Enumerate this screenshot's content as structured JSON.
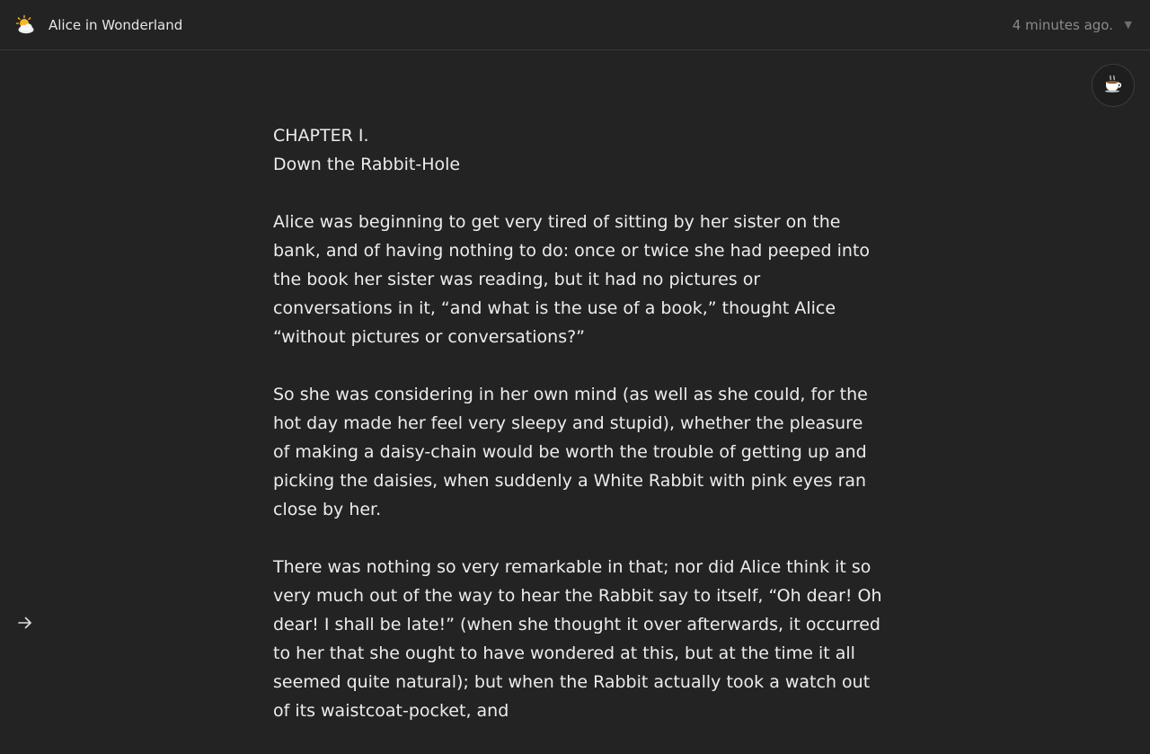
{
  "header": {
    "app_icon": "sun-behind-cloud-icon",
    "title": "Alice in Wonderland",
    "timestamp": "4 minutes ago.",
    "timestamp_menu_icon": "caret-down-icon"
  },
  "toolbar": {
    "theme_button_icon": "hot-beverage-icon"
  },
  "document": {
    "chapter_number": "CHAPTER I.",
    "chapter_title": "Down the Rabbit-Hole",
    "paragraphs": [
      "Alice was beginning to get very tired of sitting by her sister on the bank, and of having nothing to do: once or twice she had peeped into the book her sister was reading, but it had no pictures or conversations in it, “and what is the use of a book,” thought Alice “without pictures or conversations?”",
      "So she was considering in her own mind (as well as she could, for the hot day made her feel very sleepy and stupid), whether the pleasure of making a daisy-chain would be worth the trouble of getting up and picking the daisies, when suddenly a White Rabbit with pink eyes ran close by her.",
      "There was nothing so very remarkable in that; nor did Alice think it so very much out of the way to hear the Rabbit say to itself, “Oh dear! Oh dear! I shall be late!” (when she thought it over afterwards, it occurred to her that she ought to have wondered at this, but at the time it all seemed quite natural); but when the Rabbit actually took a watch out of its waistcoat-pocket, and"
    ]
  },
  "footer": {
    "next_icon": "arrow-right-icon"
  }
}
